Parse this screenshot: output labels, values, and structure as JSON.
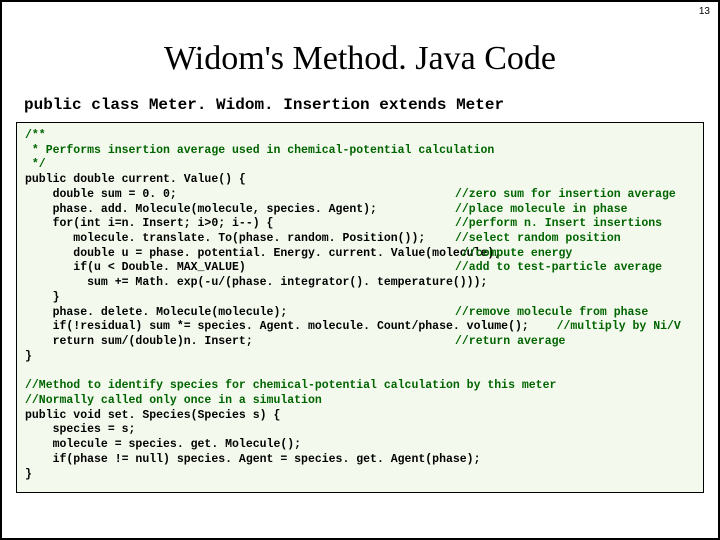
{
  "page_number": "13",
  "title": "Widom's Method.  Java Code",
  "class_decl": "public class Meter. Widom. Insertion extends Meter",
  "code": {
    "block1_comment_open": "/**",
    "block1_comment_line": " * Performs insertion average used in chemical-potential calculation",
    "block1_comment_close": " */",
    "l01": "public double current. Value() {",
    "l02": "    double sum = 0. 0;",
    "c02": "//zero sum for insertion average",
    "l03": "    phase. add. Molecule(molecule, species. Agent);",
    "c03": "//place molecule in phase",
    "l04": "    for(int i=n. Insert; i>0; i--) {",
    "c04": "//perform n. Insert insertions",
    "l05": "       molecule. translate. To(phase. random. Position());",
    "c05": "//select random position",
    "l06": "       double u = phase. potential. Energy. current. Value(molecule);",
    "c06": " //compute energy",
    "l07": "       if(u < Double. MAX_VALUE)",
    "c07": "//add to test-particle average",
    "l08": "         sum += Math. exp(-u/(phase. integrator(). temperature()));",
    "l09": "    }",
    "l10": "    phase. delete. Molecule(molecule);",
    "c10": "//remove molecule from phase",
    "l11": "    if(!residual) sum *= species. Agent. molecule. Count/phase. volume();",
    "c11": "    //multiply by Ni/V",
    "l12": "    return sum/(double)n. Insert;",
    "c12": "//return average",
    "l13": "}",
    "blank": " ",
    "m_c1": "//Method to identify species for chemical-potential calculation by this meter",
    "m_c2": "//Normally called only once in a simulation",
    "m1": "public void set. Species(Species s) {",
    "m2": "    species = s;",
    "m3": "    molecule = species. get. Molecule();",
    "m4": "    if(phase != null) species. Agent = species. get. Agent(phase);",
    "m5": "}"
  }
}
